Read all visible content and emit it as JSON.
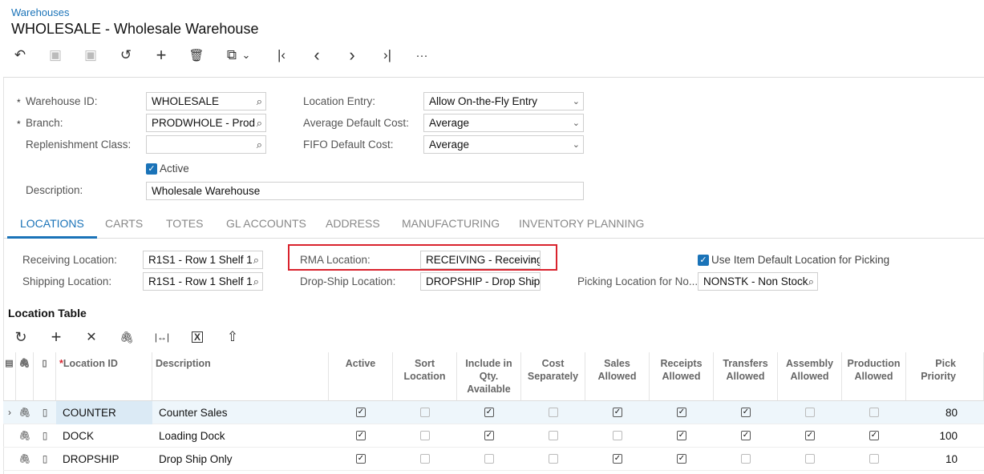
{
  "breadcrumb": "Warehouses",
  "title": "WHOLESALE - Wholesale Warehouse",
  "toolbar": {
    "back": "↶",
    "save_close": "▣",
    "save": "▣",
    "undo": "↺",
    "add": "+",
    "delete": "🗑",
    "copy": "⧉",
    "copy_menu": "⌄",
    "first": "|‹",
    "prev": "‹",
    "next": "›",
    "last": "›|",
    "more": "···"
  },
  "form": {
    "warehouse_id_label": "Warehouse ID:",
    "warehouse_id": "WHOLESALE",
    "branch_label": "Branch:",
    "branch": "PRODWHOLE - Prod",
    "replenishment_label": "Replenishment Class:",
    "replenishment": "",
    "active_label": "Active",
    "description_label": "Description:",
    "description": "Wholesale Warehouse",
    "location_entry_label": "Location Entry:",
    "location_entry": "Allow On-the-Fly Entry",
    "avg_cost_label": "Average Default Cost:",
    "avg_cost": "Average",
    "fifo_cost_label": "FIFO Default Cost:",
    "fifo_cost": "Average"
  },
  "tabs": [
    "LOCATIONS",
    "CARTS",
    "TOTES",
    "GL ACCOUNTS",
    "ADDRESS",
    "MANUFACTURING",
    "INVENTORY PLANNING"
  ],
  "locations": {
    "receiving_label": "Receiving Location:",
    "receiving": "R1S1 - Row 1 Shelf 1",
    "shipping_label": "Shipping Location:",
    "shipping": "R1S1 - Row 1 Shelf 1",
    "rma_label": "RMA Location:",
    "rma": "RECEIVING - Receiving",
    "dropship_label": "Drop-Ship Location:",
    "dropship": "DROPSHIP - Drop Ship",
    "use_default_label": "Use Item Default Location for Picking",
    "picking_nonstock_label": "Picking Location for No...",
    "picking_nonstock": "NONSTK - Non Stock"
  },
  "table": {
    "title": "Location Table",
    "toolbar": {
      "refresh": "↻",
      "add": "+",
      "delete": "✕",
      "attach": "🖇",
      "fit": "|↔|",
      "excel": "X",
      "upload": "⇧"
    },
    "columns": [
      "Location ID",
      "Description",
      "Active",
      "Sort Location",
      "Include in Qty. Available",
      "Cost Separately",
      "Sales Allowed",
      "Receipts Allowed",
      "Transfers Allowed",
      "Assembly Allowed",
      "Production Allowed",
      "Pick Priority"
    ],
    "rows": [
      {
        "id": "COUNTER",
        "desc": "Counter Sales",
        "flags": [
          true,
          false,
          true,
          false,
          true,
          true,
          true,
          false,
          false
        ],
        "priority": "80"
      },
      {
        "id": "DOCK",
        "desc": "Loading Dock",
        "flags": [
          true,
          false,
          true,
          false,
          false,
          true,
          true,
          true,
          true
        ],
        "priority": "100"
      },
      {
        "id": "DROPSHIP",
        "desc": "Drop Ship Only",
        "flags": [
          true,
          false,
          false,
          false,
          true,
          true,
          false,
          false,
          false
        ],
        "priority": "10"
      }
    ]
  },
  "colors": {
    "accent": "#1a73b8",
    "highlight": "#d9232d"
  }
}
